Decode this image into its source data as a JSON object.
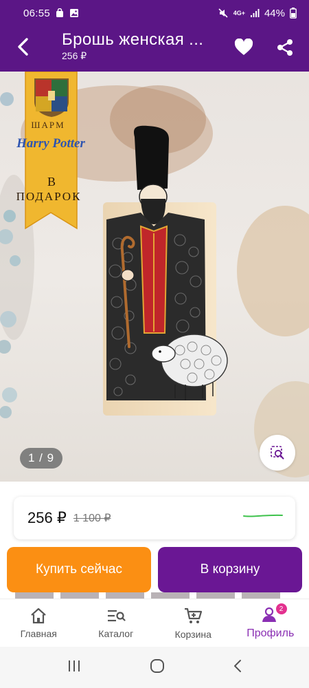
{
  "status_bar": {
    "time": "06:55",
    "network": "4G+",
    "battery": "44%"
  },
  "app_bar": {
    "title": "Брошь женская ...",
    "subtitle": "256 ₽"
  },
  "gallery": {
    "counter": "1 / 9",
    "promo": {
      "line1": "ШАРМ",
      "line2": "Harry Potter",
      "line3": "В",
      "line4": "ПОДАРОК"
    }
  },
  "price": {
    "current": "256 ₽",
    "old": "1 100 ₽"
  },
  "actions": {
    "buy_now": "Купить сейчас",
    "add_to_cart": "В корзину"
  },
  "bottom_nav": {
    "items": [
      {
        "label": "Главная",
        "icon": "home-icon"
      },
      {
        "label": "Каталог",
        "icon": "catalog-icon"
      },
      {
        "label": "Корзина",
        "icon": "cart-icon"
      },
      {
        "label": "Профиль",
        "icon": "profile-icon",
        "badge": "2",
        "active": true
      }
    ]
  },
  "colors": {
    "header": "#5b1686",
    "buy": "#fb8f13",
    "cart": "#6a1794",
    "active_nav": "#8a2fb3",
    "badge": "#e3318f"
  }
}
